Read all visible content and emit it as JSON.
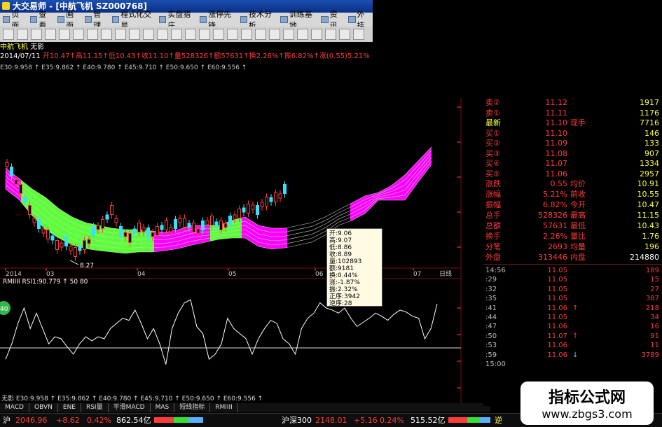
{
  "window": {
    "title": "大交易师 - [中航飞机 SZ000768]"
  },
  "menu": [
    {
      "label": "页面"
    },
    {
      "label": "查看"
    },
    {
      "label": "画面"
    },
    {
      "label": "管理"
    },
    {
      "label": "程式化交易"
    },
    {
      "label": "实盘猎庄"
    },
    {
      "label": "涨停先锋"
    },
    {
      "label": "技术分析"
    },
    {
      "label": "训练基地"
    },
    {
      "label": "资讯"
    },
    {
      "label": "外挂"
    }
  ],
  "stock": {
    "name": "中航飞机",
    "mode": "无影",
    "date": "2014/07/11",
    "quote": "开10.47↑高11.15↑低10.43↑收11.10↑量528326↑额57631↑换2.26%↑振6.82%↑涨(0.55)5.21%"
  },
  "ma_line": "E30:9.958 ↑ E35:9.862 ↑ E40:9.780 ↑ E45:9.710 ↑ E50:9.650 ↑ E60:9.556 ↑",
  "price_axis": [
    "10.50",
    "10.00",
    "9.50",
    "9.00",
    "8.50"
  ],
  "rsi_axis": [
    "80.00",
    "60.00",
    "40.00",
    "20.00"
  ],
  "time_axis": [
    "2014",
    "03",
    "04",
    "05",
    "06",
    "07"
  ],
  "time_axis_unit": "日线",
  "low_label": "8.27",
  "rsi_header": "RMIIII RSI1:90.779 ↑ 50 80",
  "rsi_badge": "40",
  "tooltip": [
    "开:9.06",
    "高:9.07",
    "低:8.86",
    "收:8.89",
    "量:102893",
    "额:9181",
    "换:0.44%",
    "涨:-1.87%",
    "振:2.32%",
    "正序:3942",
    "逆序:28"
  ],
  "bottom_ma": "无影 E30:9.958 ↑ E35:9.862 ↑ E40:9.780 ↑ E45:9.710 ↑ E50:9.650 ↑ E60:9.556 ↑",
  "tabs": [
    "MACD",
    "OBVN",
    "ENE",
    "RSI量",
    "平滑MACD",
    "MAS",
    "短线指标",
    "RMIIII"
  ],
  "order_book": [
    {
      "label": "卖②",
      "price": "11.12",
      "vol": "1917"
    },
    {
      "label": "卖①",
      "price": "11.11",
      "vol": "1176"
    },
    {
      "label": "最新",
      "price": "11.10",
      "lb2": "现手",
      "vol": "7716"
    },
    {
      "label": "买①",
      "price": "11.10",
      "vol": "146"
    },
    {
      "label": "买②",
      "price": "11.09",
      "vol": "133"
    },
    {
      "label": "买③",
      "price": "11.08",
      "vol": "907"
    },
    {
      "label": "买④",
      "price": "11.07",
      "vol": "1334"
    },
    {
      "label": "买⑤",
      "price": "11.06",
      "vol": "2957"
    }
  ],
  "stats": [
    {
      "l1": "涨跌",
      "v1": "0.55",
      "l2": "均价",
      "v2": "10.91"
    },
    {
      "l1": "涨幅",
      "v1": "5.21%",
      "l2": "前收",
      "v2": "10.55"
    },
    {
      "l1": "振幅",
      "v1": "6.82%",
      "l2": "今开",
      "v2": "10.47"
    },
    {
      "l1": "总手",
      "v1": "528326",
      "l2": "最高",
      "v2": "11.15"
    },
    {
      "l1": "总额",
      "v1": "57631",
      "l2": "最低",
      "v2": "10.43"
    },
    {
      "l1": "换手",
      "v1": "2.26%",
      "l2": "量比",
      "v2": "1.76"
    },
    {
      "l1": "分笔",
      "v1": "2693",
      "l2": "均量",
      "v2": "196"
    },
    {
      "l1": "外盘",
      "v1": "313446",
      "l2": "内盘",
      "v2": "214880"
    }
  ],
  "ticks": [
    {
      "t": "14:56",
      "p": "11.05",
      "ar": "",
      "v": "189"
    },
    {
      "t": ":29",
      "p": "11.05",
      "ar": "",
      "v": "15"
    },
    {
      "t": ":32",
      "p": "11.05",
      "ar": "",
      "v": "27"
    },
    {
      "t": ":35",
      "p": "11.05",
      "ar": "",
      "v": "387"
    },
    {
      "t": ":41",
      "p": "11.06",
      "ar": "↑",
      "v": "218"
    },
    {
      "t": ":44",
      "p": "11.05",
      "ar": "",
      "v": "34"
    },
    {
      "t": ":47",
      "p": "11.06",
      "ar": "",
      "v": "16"
    },
    {
      "t": ":50",
      "p": "11.07",
      "ar": "↑",
      "v": "91"
    },
    {
      "t": ":53",
      "p": "11.06",
      "ar": "",
      "v": "11"
    },
    {
      "t": ":59",
      "p": "11.06",
      "ar": "↓",
      "v": "3789"
    },
    {
      "t": "15:00",
      "p": "",
      "ar": "",
      "v": ""
    }
  ],
  "status": {
    "sh_label": "沪",
    "sh_value": "2046.96",
    "sh_change": "+8.62",
    "sh_pct": "0.42%",
    "sh_amount": "862.54亿",
    "hs_label": "沪深300",
    "hs_value": "2148.01",
    "hs_change": "+5.16",
    "hs_pct": "0.24%",
    "hs_amount": "515.52亿",
    "tail": "逆"
  },
  "watermark": {
    "line1": "指标公式网",
    "line2": "www.zbgs3.com"
  },
  "colors": {
    "up": "#ff3c3c",
    "down": "#36e036",
    "magenta": "#ff00ff",
    "bg": "#000000"
  }
}
